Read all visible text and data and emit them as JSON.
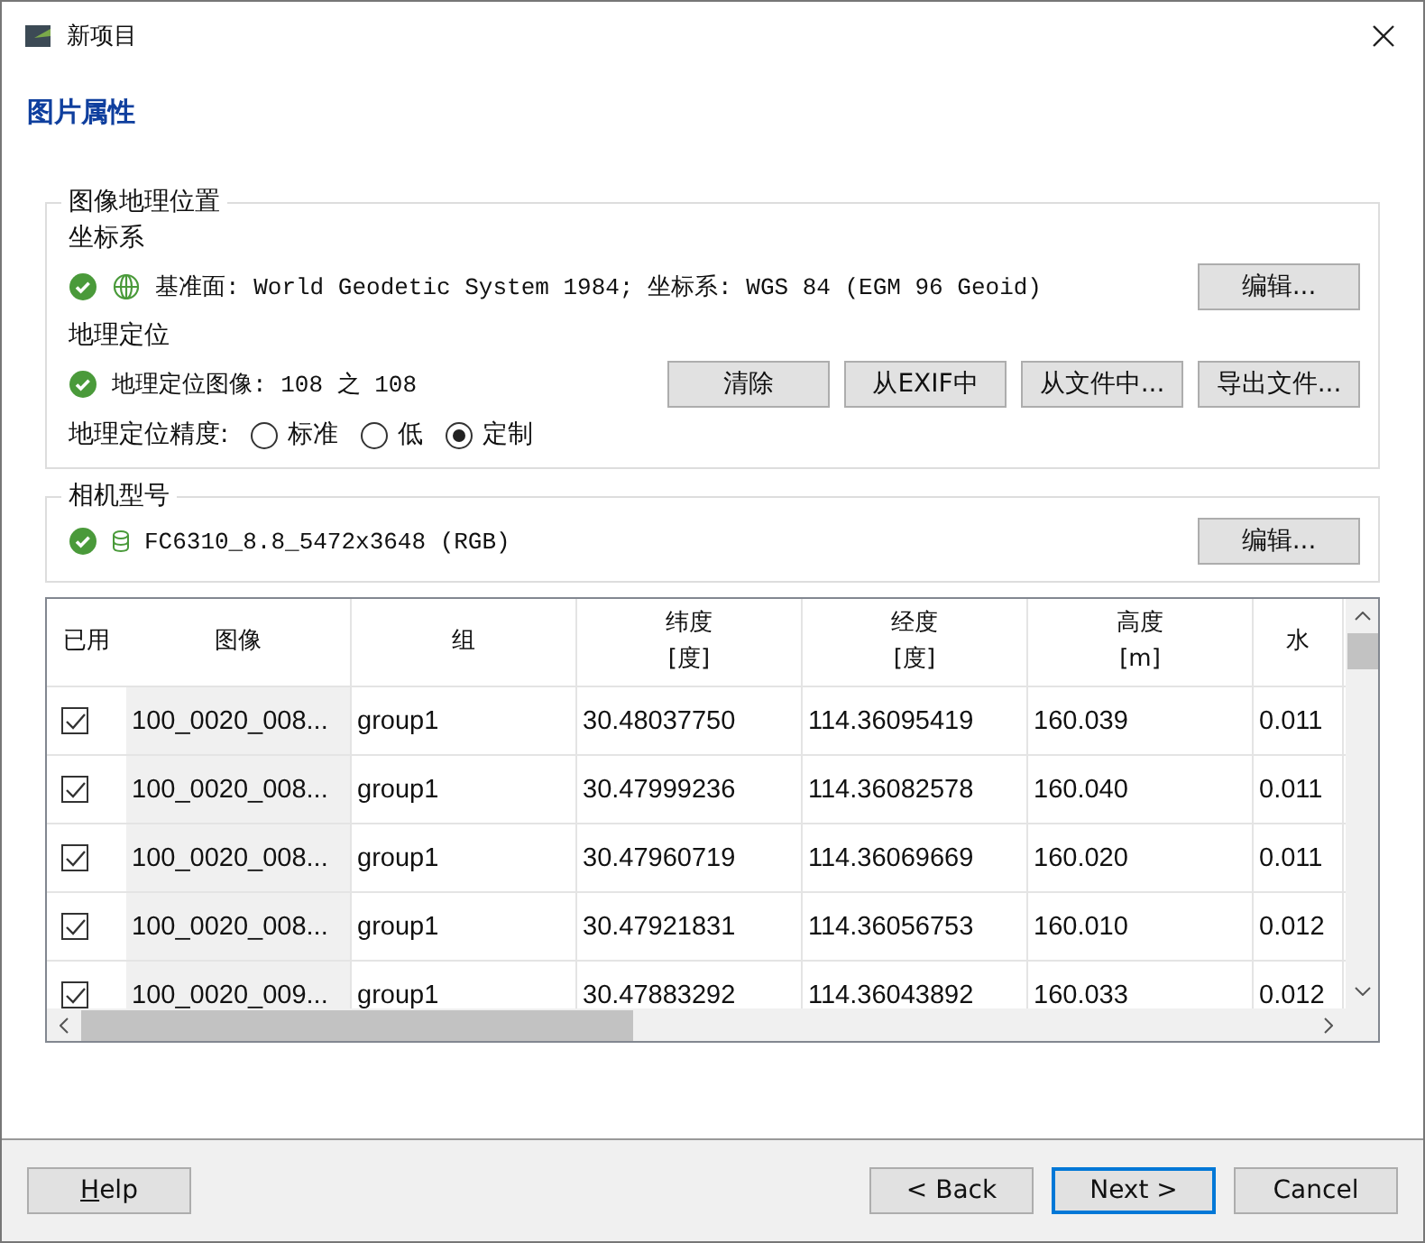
{
  "window": {
    "title": "新项目"
  },
  "heading": "图片属性",
  "geo_group": {
    "title": "图像地理位置",
    "crs": {
      "label": "坐标系",
      "status_ok": true,
      "text": "基准面: World Geodetic System 1984; 坐标系: WGS 84 (EGM 96 Geoid)",
      "button": "编辑..."
    },
    "georef": {
      "label": "地理定位",
      "status_ok": true,
      "text": "地理定位图像: 108 之 108",
      "buttons": [
        "清除",
        "从EXIF中",
        "从文件中...",
        "导出文件..."
      ]
    },
    "accuracy": {
      "label": "地理定位精度:",
      "options": [
        {
          "label": "标准",
          "selected": false
        },
        {
          "label": "低",
          "selected": false
        },
        {
          "label": "定制",
          "selected": true
        }
      ]
    }
  },
  "camera_group": {
    "title": "相机型号",
    "status_ok": true,
    "text": "FC6310_8.8_5472x3648 (RGB)",
    "button": "编辑..."
  },
  "table": {
    "checkbox_column": "已用",
    "columns": [
      "图像",
      "组",
      "纬度\n[度]",
      "经度\n[度]",
      "高度\n[m]",
      "水"
    ],
    "rows": [
      {
        "checked": true,
        "cells": [
          "100_0020_008...",
          "group1",
          "30.48037750",
          "114.36095419",
          "160.039",
          "0.011"
        ]
      },
      {
        "checked": true,
        "cells": [
          "100_0020_008...",
          "group1",
          "30.47999236",
          "114.36082578",
          "160.040",
          "0.011"
        ]
      },
      {
        "checked": true,
        "cells": [
          "100_0020_008...",
          "group1",
          "30.47960719",
          "114.36069669",
          "160.020",
          "0.011"
        ]
      },
      {
        "checked": true,
        "cells": [
          "100_0020_008...",
          "group1",
          "30.47921831",
          "114.36056753",
          "160.010",
          "0.012"
        ]
      },
      {
        "checked": true,
        "cells": [
          "100_0020_009...",
          "group1",
          "30.47883292",
          "114.36043892",
          "160.033",
          "0.012"
        ]
      }
    ]
  },
  "footer": {
    "help": "Help",
    "back": "< Back",
    "next": "Next >",
    "cancel": "Cancel"
  }
}
